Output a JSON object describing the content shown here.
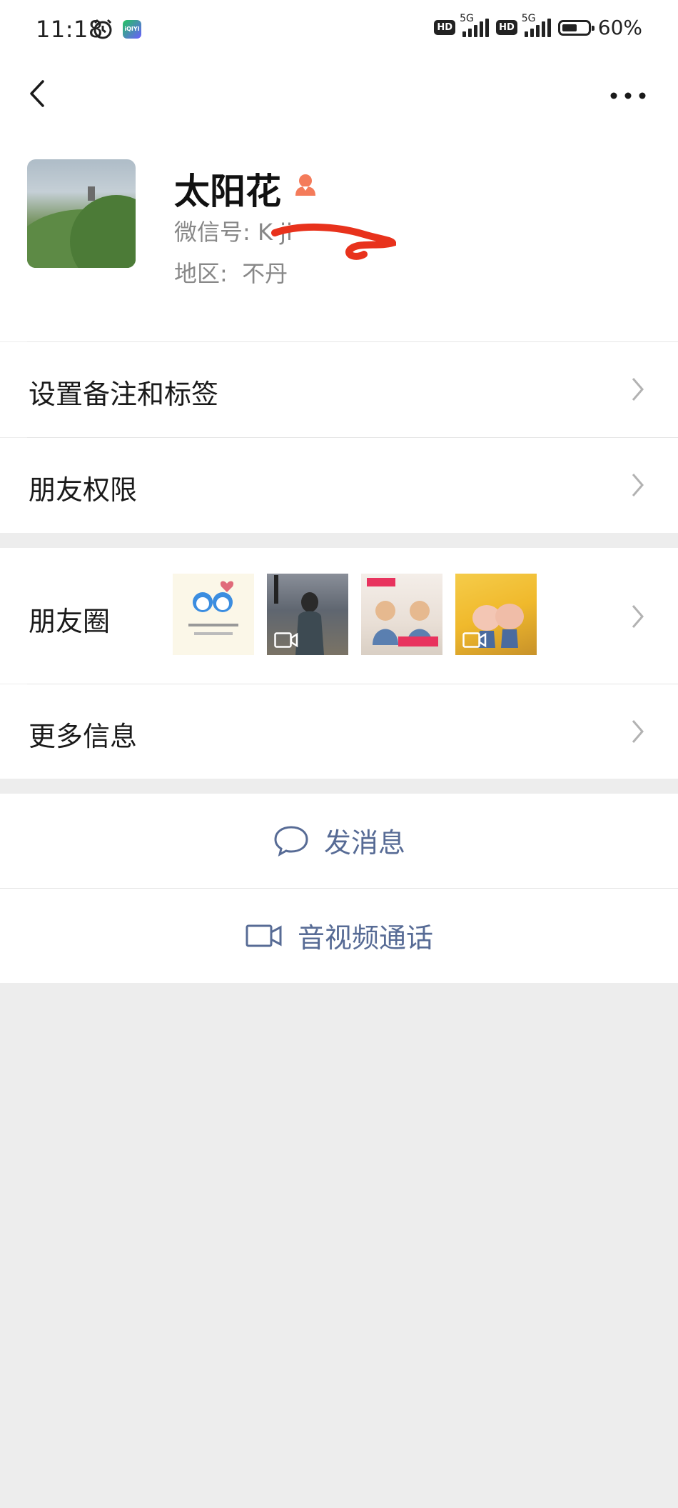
{
  "status_bar": {
    "time": "11:18",
    "app_badge": "iQIYI",
    "net1": "5G",
    "net2": "5G",
    "hd1": "HD",
    "hd2": "HD",
    "battery_pct": "60%",
    "battery_level": 0.6
  },
  "nav": {
    "back_icon": "chevron-left-icon",
    "more_icon": "ellipsis-icon"
  },
  "profile": {
    "name": "太阳花",
    "gender_icon": "female-user-icon",
    "wechat_id_label": "微信号:",
    "wechat_id_value": "K    ji",
    "region_label": "地区:",
    "region_value": "不丹"
  },
  "menu": {
    "remark_tags": "设置备注和标签",
    "permissions": "朋友权限",
    "moments": "朋友圈",
    "more_info": "更多信息"
  },
  "moments_thumbs": [
    {
      "caption": "希望你快乐  今天 明天 后天 天天"
    },
    {
      "caption": ""
    },
    {
      "caption": "相逢是缘 天天都美好"
    },
    {
      "caption": ""
    }
  ],
  "actions": {
    "send_message": "发消息",
    "av_call": "音视频通话"
  },
  "colors": {
    "link_blue": "#576b95",
    "page_bg": "#ededed",
    "gender_orange": "#f47b5a",
    "redaction": "#e8321c"
  }
}
